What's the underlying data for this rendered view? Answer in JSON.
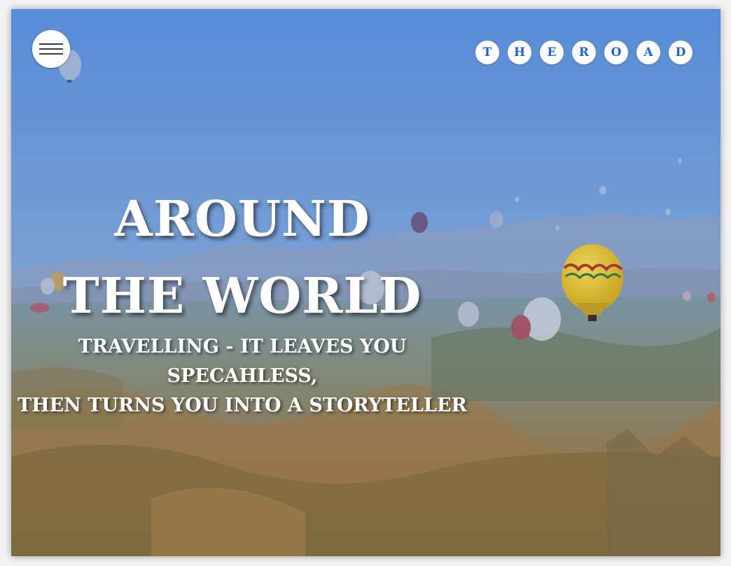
{
  "header": {
    "menu_icon": "hamburger-menu-icon",
    "logo_letters": [
      "T",
      "H",
      "E",
      "R",
      "O",
      "A",
      "D"
    ]
  },
  "hero": {
    "title": "AROUND THE WORLD",
    "subtitle_line1": "TRAVELLING - IT LEAVES YOU SPECAHLESS,",
    "subtitle_line2": "THEN TURNS YOU INTO A STORYTELLER",
    "background": "hot-air-balloons-over-valley-photo"
  },
  "colors": {
    "accent": "#1a63d8",
    "sky_top": "#5b8fd6",
    "text": "#ffffff"
  }
}
